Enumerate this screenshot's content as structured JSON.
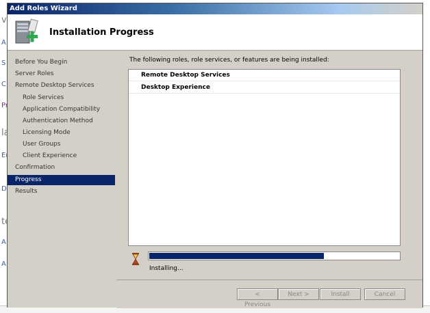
{
  "window": {
    "title": "Add Roles Wizard"
  },
  "header": {
    "title": "Installation Progress",
    "icon": "server-add-icon"
  },
  "nav": {
    "items": [
      {
        "label": "Before You Begin"
      },
      {
        "label": "Server Roles"
      },
      {
        "label": "Remote Desktop Services"
      },
      {
        "label": "Role Services"
      },
      {
        "label": "Application Compatibility"
      },
      {
        "label": "Authentication Method"
      },
      {
        "label": "Licensing Mode"
      },
      {
        "label": "User Groups"
      },
      {
        "label": "Client Experience"
      },
      {
        "label": "Confirmation"
      },
      {
        "label": "Progress"
      },
      {
        "label": "Results"
      }
    ],
    "active": "Progress"
  },
  "content": {
    "intro": "The following roles, role services, or features are being installed:",
    "items": [
      "Remote Desktop Services",
      "Desktop Experience"
    ],
    "progress": 0.7,
    "status": "Installing..."
  },
  "buttons": {
    "previous": "< Previous",
    "next": "Next >",
    "install": "Install",
    "cancel": "Cancel"
  },
  "background": {
    "fragments": [
      "v",
      "A",
      "S",
      "C",
      "Pr",
      "la",
      "Er",
      "D",
      "te",
      "A",
      "A"
    ]
  },
  "colors": {
    "selection": "#0a246a",
    "progress_fill": "#0a246a",
    "dialog_bg": "#d4d0c8"
  }
}
